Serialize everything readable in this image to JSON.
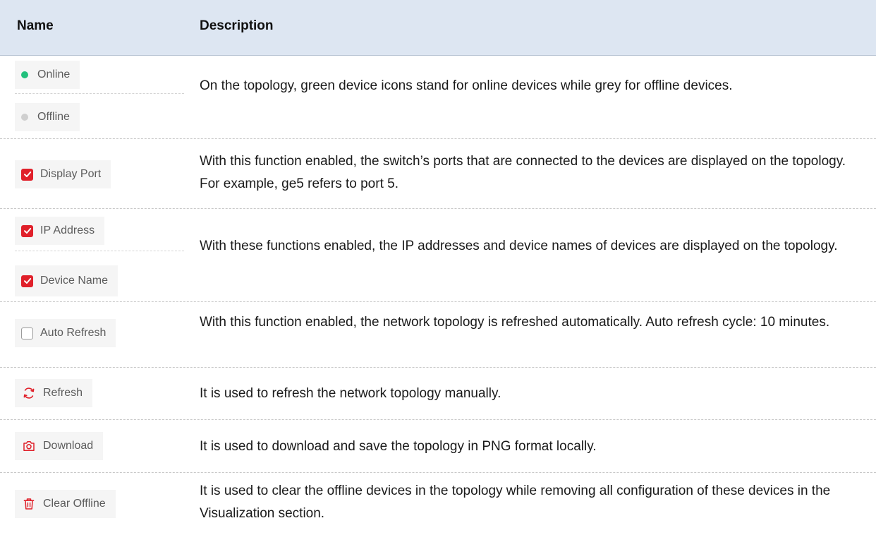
{
  "header": {
    "name": "Name",
    "description": "Description"
  },
  "rows": {
    "status": {
      "online_label": "Online",
      "offline_label": "Offline",
      "description": "On the topology, green device icons stand for online devices while grey for offline devices."
    },
    "display_port": {
      "label": "Display Port",
      "checked": true,
      "description": "With this function enabled, the switch’s ports that are connected to the devices are displayed on the topology. For example, ge5 refers to port 5."
    },
    "ip_name": {
      "ip_label": "IP Address",
      "ip_checked": true,
      "name_label": "Device Name",
      "name_checked": true,
      "description": "With these functions enabled, the IP addresses and device names of devices are displayed on the topology."
    },
    "auto_refresh": {
      "label": "Auto Refresh",
      "checked": false,
      "description": "With this function enabled, the network topology is refreshed automatically. Auto refresh cycle: 10 minutes."
    },
    "refresh": {
      "label": "Refresh",
      "icon": "refresh-icon",
      "description": "It is used to refresh the network topology manually."
    },
    "download": {
      "label": "Download",
      "icon": "camera-icon",
      "description": "It is used to download and save the topology in PNG format locally."
    },
    "clear_offline": {
      "label": "Clear Offline",
      "icon": "trash-icon",
      "description": "It is used to clear the offline devices in the topology while removing all configuration of these devices in the Visualization section."
    }
  },
  "colors": {
    "header_bg": "#dde6f2",
    "accent_red": "#e0202a",
    "online_green": "#22c07c",
    "offline_grey": "#cfcfcf",
    "control_bg": "#f5f5f5"
  }
}
